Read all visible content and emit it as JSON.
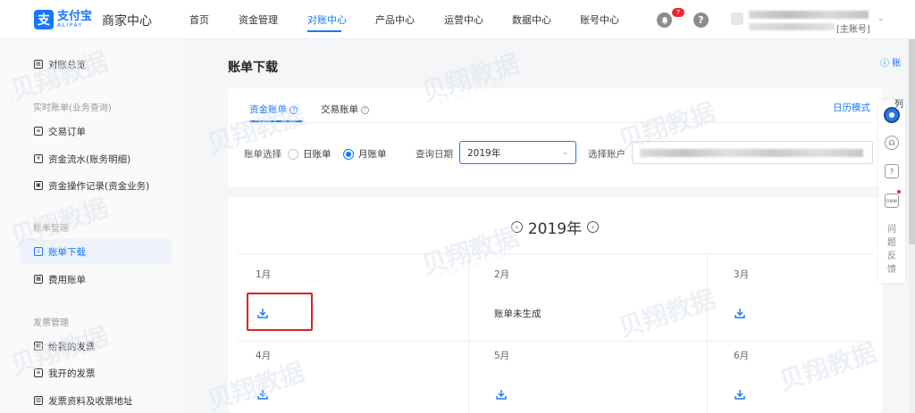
{
  "brand": {
    "logo_char": "支",
    "name_cn": "支付宝",
    "name_en": "ALIPAY",
    "subtitle": "商家中心"
  },
  "nav": {
    "items": [
      "首页",
      "资金管理",
      "对账中心",
      "产品中心",
      "运营中心",
      "数据中心",
      "账号中心"
    ],
    "active_index": 2
  },
  "header": {
    "notification_count": "7",
    "help_glyph": "?",
    "user_role": "[主账号]"
  },
  "sidebar": {
    "overview": "对账总览",
    "group1": "实时账单(业务查询)",
    "group1_items": [
      "交易订单",
      "资金流水(账务明细)",
      "资金操作记录(资金业务)"
    ],
    "group2": "账单管理",
    "group2_items": [
      "账单下载",
      "费用账单"
    ],
    "group3": "发票管理",
    "group3_items": [
      "给我的发票",
      "我开的发票",
      "发票资料及收票地址"
    ],
    "active": "账单下载"
  },
  "main": {
    "title": "账单下载",
    "help_link": "账",
    "tabs": [
      "资金账单",
      "交易账单"
    ],
    "active_tab": "资金账单",
    "calendar_mode": "日历模式",
    "bill_select_label": "账单选择",
    "radio_day": "日账单",
    "radio_month": "月账单",
    "radio_checked": "月账单",
    "query_date_label": "查询日期",
    "query_date_value": "2019年",
    "account_label": "选择账户"
  },
  "calendar": {
    "year_label": "2019年",
    "months": [
      {
        "name": "1月",
        "status": "download"
      },
      {
        "name": "2月",
        "status": "账单未生成"
      },
      {
        "name": "3月",
        "status": "download"
      },
      {
        "name": "4月",
        "status": "download"
      },
      {
        "name": "5月",
        "status": "download"
      },
      {
        "name": "6月",
        "status": "download"
      }
    ]
  },
  "float_toolbar": {
    "menu_label": "列",
    "new_label": "new",
    "feedback": "问题反馈"
  },
  "watermark": {
    "text": "贝翔教据",
    "sub": "XENCIO.COM"
  },
  "colors": {
    "accent": "#1677ff",
    "highlight": "#e02020"
  }
}
